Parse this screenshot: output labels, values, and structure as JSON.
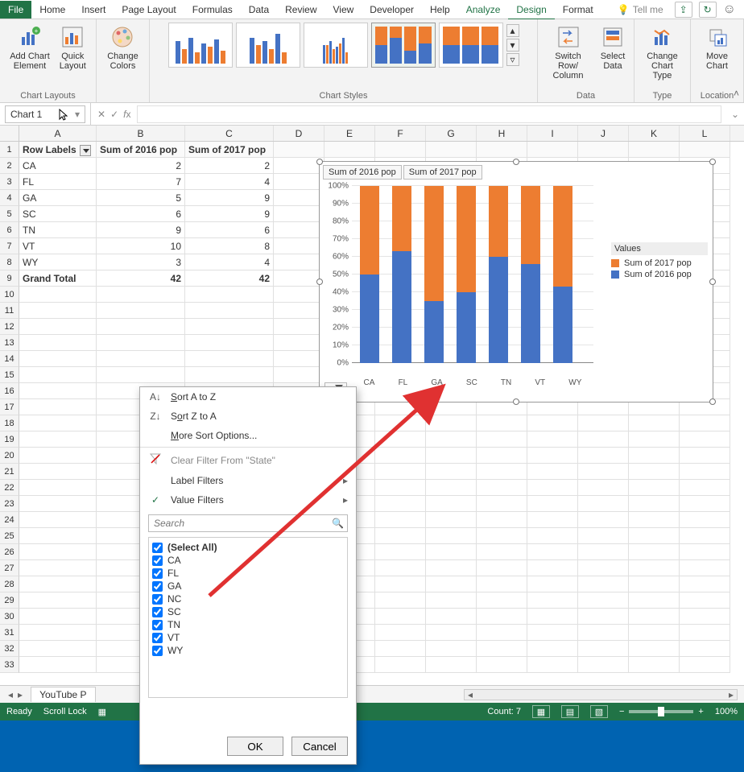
{
  "tabs": {
    "file": "File",
    "home": "Home",
    "insert": "Insert",
    "pagelayout": "Page Layout",
    "formulas": "Formulas",
    "data": "Data",
    "review": "Review",
    "view": "View",
    "developer": "Developer",
    "help": "Help",
    "analyze": "Analyze",
    "design": "Design",
    "format": "Format",
    "tellme": "Tell me"
  },
  "ribbon": {
    "add_chart_element": "Add Chart\nElement",
    "quick_layout": "Quick\nLayout",
    "change_colors": "Change\nColors",
    "switch_rowcol": "Switch Row/\nColumn",
    "select_data": "Select\nData",
    "change_chart_type": "Change\nChart Type",
    "move_chart": "Move\nChart",
    "group_chartlayouts": "Chart Layouts",
    "group_chartstyles": "Chart Styles",
    "group_data": "Data",
    "group_type": "Type",
    "group_location": "Location"
  },
  "namebox": "Chart 1",
  "colheads": [
    "A",
    "B",
    "C",
    "D",
    "E",
    "F",
    "G",
    "H",
    "I",
    "J",
    "K",
    "L"
  ],
  "table": {
    "headers": [
      "Row Labels",
      "Sum of 2016 pop",
      "Sum of 2017 pop"
    ],
    "rows": [
      {
        "label": "CA",
        "a": 2,
        "b": 2
      },
      {
        "label": "FL",
        "a": 7,
        "b": 4
      },
      {
        "label": "GA",
        "a": 5,
        "b": 9
      },
      {
        "label": "SC",
        "a": 6,
        "b": 9
      },
      {
        "label": "TN",
        "a": 9,
        "b": 6
      },
      {
        "label": "VT",
        "a": 10,
        "b": 8
      },
      {
        "label": "WY",
        "a": 3,
        "b": 4
      }
    ],
    "total": {
      "label": "Grand Total",
      "a": 42,
      "b": 42
    }
  },
  "chart_data": {
    "type": "bar",
    "stacked": "percent",
    "title_buttons": [
      "Sum of 2016 pop",
      "Sum of 2017 pop"
    ],
    "legend_title": "Values",
    "series": [
      {
        "name": "Sum of 2016 pop",
        "color": "#4472c4",
        "values": [
          50,
          63,
          35,
          40,
          60,
          56,
          43
        ]
      },
      {
        "name": "Sum of 2017 pop",
        "color": "#ed7d31",
        "values": [
          50,
          37,
          65,
          60,
          40,
          44,
          57
        ]
      }
    ],
    "categories": [
      "CA",
      "FL",
      "GA",
      "SC",
      "TN",
      "VT",
      "WY"
    ],
    "yticks": [
      "0%",
      "10%",
      "20%",
      "30%",
      "40%",
      "50%",
      "60%",
      "70%",
      "80%",
      "90%",
      "100%"
    ],
    "ylim": [
      0,
      100
    ]
  },
  "filter": {
    "sort_az": "Sort A to Z",
    "sort_za": "Sort Z to A",
    "more_sort": "More Sort Options...",
    "clear": "Clear Filter From \"State\"",
    "label_filters": "Label Filters",
    "value_filters": "Value Filters",
    "search_placeholder": "Search",
    "select_all": "(Select All)",
    "items": [
      "CA",
      "FL",
      "GA",
      "NC",
      "SC",
      "TN",
      "VT",
      "WY"
    ],
    "ok": "OK",
    "cancel": "Cancel"
  },
  "sheet": {
    "tab1": "YouTube P"
  },
  "status": {
    "ready": "Ready",
    "scrolllock": "Scroll Lock",
    "count": "Count: 7",
    "zoom": "100%"
  }
}
